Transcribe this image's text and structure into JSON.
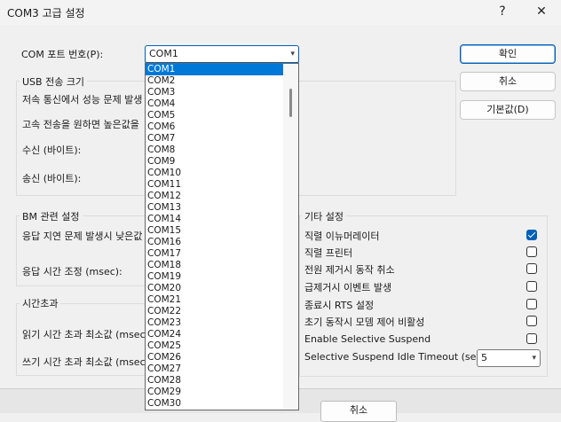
{
  "window": {
    "title": "COM3 고급 설정",
    "help": "?",
    "close": "✕"
  },
  "port": {
    "label": "COM 포트 번호(P):",
    "selected": "COM1"
  },
  "buttons": {
    "ok": "확인",
    "cancel": "취소",
    "defaults": "기본값(D)"
  },
  "usb": {
    "legend": "USB 전송 크기",
    "text1": "저속 통신에서 성능 문제 발생",
    "text2": "고속 전송을 원하면 높은값을",
    "receive": "수신 (바이트):",
    "send": "송신 (바이트):"
  },
  "bm": {
    "legend": "BM 관련 설정",
    "text1": "응답 지연 문제 발생시 낮은값",
    "timeout": "응답 시간 조정 (msec):"
  },
  "timeouts": {
    "legend": "시간초과",
    "read": "읽기 시간 초과 최소값 (msec",
    "write": "쓰기 시간 초과 최소값 (msec"
  },
  "misc": {
    "legend": "기타 설정",
    "options": [
      {
        "label": "직렬 이뉴머레이터",
        "checked": true
      },
      {
        "label": "직렬 프린터",
        "checked": false
      },
      {
        "label": "전원 제거시 동작 취소",
        "checked": false
      },
      {
        "label": "급제거시 이벤트 발생",
        "checked": false
      },
      {
        "label": "종료시 RTS 설정",
        "checked": false
      },
      {
        "label": "초기 동작시 모뎀 제어 비활성",
        "checked": false
      },
      {
        "label": "Enable Selective Suspend",
        "checked": false
      }
    ],
    "idle_label": "Selective Suspend Idle Timeout (secs):",
    "idle_value": "5"
  },
  "dropdown_items": [
    "COM1",
    "COM2",
    "COM3",
    "COM4",
    "COM5",
    "COM6",
    "COM7",
    "COM8",
    "COM9",
    "COM10",
    "COM11",
    "COM12",
    "COM13",
    "COM14",
    "COM15",
    "COM16",
    "COM17",
    "COM18",
    "COM19",
    "COM20",
    "COM21",
    "COM22",
    "COM23",
    "COM24",
    "COM25",
    "COM26",
    "COM27",
    "COM28",
    "COM29",
    "COM30"
  ],
  "background_cancel": "취소",
  "colors": {
    "accent": "#005fb8",
    "selection": "#0078d7"
  }
}
